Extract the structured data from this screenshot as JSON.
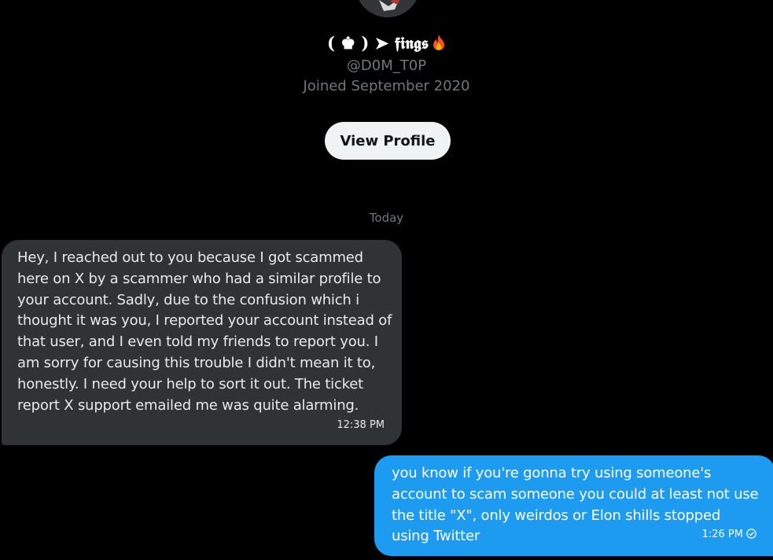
{
  "profile": {
    "display_name": "( ♚ ) ➤ 𝖋𝖎𝖓𝖌𝖘",
    "display_name_emoji_icon": "fire-icon",
    "handle": "@D0M_T0P",
    "joined": "Joined September 2020",
    "view_profile_label": "View Profile"
  },
  "conversation": {
    "date_separator": "Today",
    "messages": [
      {
        "direction": "incoming",
        "text": "Hey, I reached out to you because I got scammed here on X by a scammer who had a similar profile to your account. Sadly, due to the confusion which i thought it was you, I reported your account instead of that user, and I even told my friends to report you. I am sorry for causing this trouble I didn't mean it to, honestly. I need your help to sort it out. The ticket report X support emailed me was quite alarming.",
        "time": "12:38 PM"
      },
      {
        "direction": "outgoing",
        "text": "you know if you're gonna try using someone's account to scam someone you could at least not use the title \"X\", only weirdos or Elon shills stopped using Twitter",
        "time": "1:26 PM",
        "status_icon": "check-circle-icon"
      }
    ]
  },
  "colors": {
    "background": "#000000",
    "incoming_bubble": "#2f3336",
    "outgoing_bubble": "#1d9bf0",
    "muted_text": "#71767b",
    "button_bg": "#eff3f4"
  }
}
